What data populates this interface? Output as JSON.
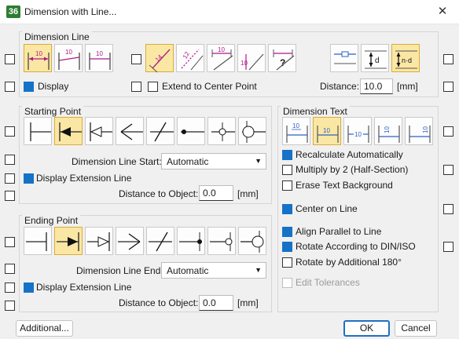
{
  "window": {
    "app_icon": "36",
    "title": "Dimension with Line...",
    "close_glyph": "✕"
  },
  "dimension_line": {
    "title": "Dimension Line",
    "display": "Display",
    "extend_to_center": "Extend to Center Point",
    "distance_label": "Distance:",
    "distance_value": "10.0",
    "distance_unit": "[mm]",
    "style_value": "10",
    "angled_value": "14",
    "oblique_value": "12",
    "vertical_value": "10",
    "unknown_value": "?",
    "offset_value": "d",
    "offset_multi_value": "n·d"
  },
  "starting_point": {
    "title": "Starting Point",
    "end_label": "Dimension Line Start:",
    "end_value": "Automatic",
    "display_ext": "Display Extension Line",
    "distance_label": "Distance to Object:",
    "distance_value": "0.0",
    "distance_unit": "[mm]"
  },
  "ending_point": {
    "title": "Ending Point",
    "end_label": "Dimension Line End:",
    "end_value": "Automatic",
    "display_ext": "Display Extension Line",
    "distance_label": "Distance to Object:",
    "distance_value": "0.0",
    "distance_unit": "[mm]"
  },
  "dimension_text": {
    "title": "Dimension Text",
    "value": "10",
    "recalculate": "Recalculate Automatically",
    "multiply": "Multiply by 2 (Half-Section)",
    "erase_bg": "Erase Text Background",
    "center": "Center on Line",
    "align_parallel": "Align Parallel to Line",
    "rotate_din": "Rotate According to DIN/ISO",
    "rotate_180": "Rotate by Additional 180°",
    "edit_tol": "Edit Tolerances"
  },
  "buttons": {
    "additional": "Additional...",
    "ok": "OK",
    "cancel": "Cancel"
  },
  "colors": {
    "accent": "#1572c7",
    "selected_bg": "#fbe7a4",
    "icon_magenta": "#b0198c",
    "icon_blue": "#2d5fc4"
  }
}
